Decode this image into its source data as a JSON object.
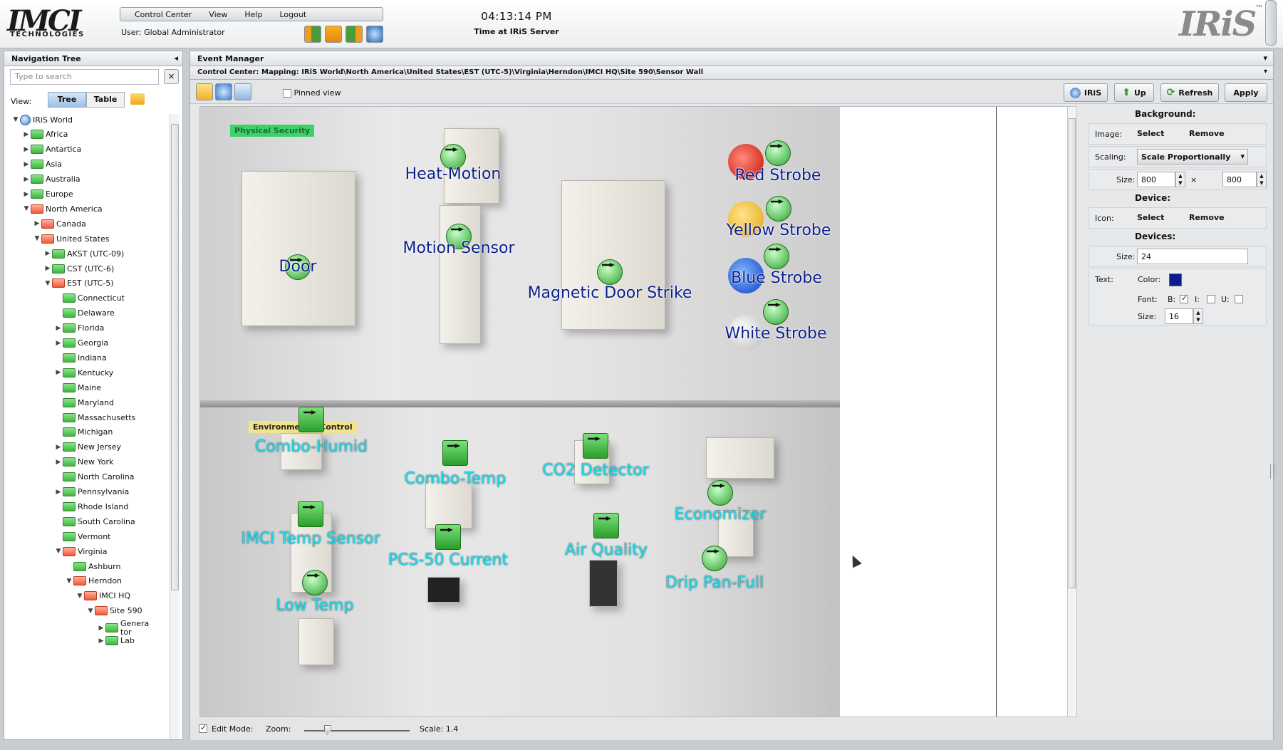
{
  "header": {
    "logo_big": "IMCI",
    "logo_small": "TECHNOLOGIES",
    "menu": [
      "Control Center",
      "View",
      "Help",
      "Logout"
    ],
    "user_label": "User:",
    "user_name": "Global Administrator",
    "clock_time": "04:13:14 PM",
    "clock_caption": "Time at IRiS Server",
    "brand": "IRiS",
    "brand_tm": "™"
  },
  "nav": {
    "title": "Navigation Tree",
    "search_placeholder": "Type to search",
    "clear": "×",
    "view_label": "View:",
    "view_tree": "Tree",
    "view_table": "Table",
    "tree": [
      {
        "label": "IRiS World",
        "level": 0,
        "state": "open",
        "icon": "globe"
      },
      {
        "label": "Africa",
        "level": 1,
        "state": "closed",
        "icon": "green"
      },
      {
        "label": "Antartica",
        "level": 1,
        "state": "closed",
        "icon": "green"
      },
      {
        "label": "Asia",
        "level": 1,
        "state": "closed",
        "icon": "green"
      },
      {
        "label": "Australia",
        "level": 1,
        "state": "closed",
        "icon": "green"
      },
      {
        "label": "Europe",
        "level": 1,
        "state": "closed",
        "icon": "green"
      },
      {
        "label": "North America",
        "level": 1,
        "state": "open",
        "icon": "red"
      },
      {
        "label": "Canada",
        "level": 2,
        "state": "closed",
        "icon": "red"
      },
      {
        "label": "United States",
        "level": 2,
        "state": "open",
        "icon": "red"
      },
      {
        "label": "AKST (UTC-09)",
        "level": 3,
        "state": "closed",
        "icon": "green"
      },
      {
        "label": "CST (UTC-6)",
        "level": 3,
        "state": "closed",
        "icon": "green"
      },
      {
        "label": "EST (UTC-5)",
        "level": 3,
        "state": "open",
        "icon": "red"
      },
      {
        "label": "Connecticut",
        "level": 4,
        "state": "",
        "icon": "green"
      },
      {
        "label": "Delaware",
        "level": 4,
        "state": "",
        "icon": "green"
      },
      {
        "label": "Florida",
        "level": 4,
        "state": "closed",
        "icon": "green"
      },
      {
        "label": "Georgia",
        "level": 4,
        "state": "closed",
        "icon": "green"
      },
      {
        "label": "Indiana",
        "level": 4,
        "state": "",
        "icon": "green"
      },
      {
        "label": "Kentucky",
        "level": 4,
        "state": "closed",
        "icon": "green"
      },
      {
        "label": "Maine",
        "level": 4,
        "state": "",
        "icon": "green"
      },
      {
        "label": "Maryland",
        "level": 4,
        "state": "",
        "icon": "green"
      },
      {
        "label": "Massachusetts",
        "level": 4,
        "state": "",
        "icon": "green"
      },
      {
        "label": "Michigan",
        "level": 4,
        "state": "",
        "icon": "green"
      },
      {
        "label": "New Jersey",
        "level": 4,
        "state": "closed",
        "icon": "green"
      },
      {
        "label": "New York",
        "level": 4,
        "state": "closed",
        "icon": "green"
      },
      {
        "label": "North Carolina",
        "level": 4,
        "state": "",
        "icon": "green"
      },
      {
        "label": "Pennsylvania",
        "level": 4,
        "state": "closed",
        "icon": "green"
      },
      {
        "label": "Rhode Island",
        "level": 4,
        "state": "",
        "icon": "green"
      },
      {
        "label": "South Carolina",
        "level": 4,
        "state": "",
        "icon": "green"
      },
      {
        "label": "Vermont",
        "level": 4,
        "state": "",
        "icon": "green"
      },
      {
        "label": "Virginia",
        "level": 4,
        "state": "open",
        "icon": "red"
      },
      {
        "label": "Ashburn",
        "level": 5,
        "state": "",
        "icon": "green"
      },
      {
        "label": "Herndon",
        "level": 5,
        "state": "open",
        "icon": "red"
      },
      {
        "label": "IMCI HQ",
        "level": 6,
        "state": "open",
        "icon": "red"
      },
      {
        "label": "Site 590",
        "level": 7,
        "state": "open",
        "icon": "red"
      },
      {
        "label": "Genera tor",
        "level": 8,
        "state": "closed",
        "icon": "green"
      },
      {
        "label": "Lab",
        "level": 8,
        "state": "closed",
        "icon": "green"
      }
    ]
  },
  "main": {
    "title": "Event Manager",
    "breadcrumb": "Control Center: Mapping: IRiS World\\North America\\United States\\EST (UTC-5)\\Virginia\\Herndon\\IMCI HQ\\Site 590\\Sensor Wall",
    "pinned_label": "Pinned view",
    "buttons": {
      "iris": "IRiS",
      "up": "Up",
      "refresh": "Refresh",
      "apply": "Apply"
    },
    "photo_tags": {
      "security": "Physical Security",
      "environment": "Environmental Control"
    },
    "devices": [
      {
        "name": "Heat-Motion",
        "color": "blue",
        "kind": "round"
      },
      {
        "name": "Motion Sensor",
        "color": "blue",
        "kind": "round"
      },
      {
        "name": "Door",
        "color": "blue",
        "kind": "round"
      },
      {
        "name": "Magnetic Door Strike",
        "color": "blue",
        "kind": "round"
      },
      {
        "name": "Red Strobe",
        "color": "blue",
        "kind": "round"
      },
      {
        "name": "Yellow Strobe",
        "color": "blue",
        "kind": "round"
      },
      {
        "name": "Blue Strobe",
        "color": "blue",
        "kind": "round"
      },
      {
        "name": "White Strobe",
        "color": "blue",
        "kind": "round"
      },
      {
        "name": "Combo-Humid",
        "color": "cyan",
        "kind": "square"
      },
      {
        "name": "Combo-Temp",
        "color": "cyan",
        "kind": "square"
      },
      {
        "name": "CO2 Detector",
        "color": "cyan",
        "kind": "square"
      },
      {
        "name": "Economizer",
        "color": "cyan",
        "kind": "round"
      },
      {
        "name": "IMCI Temp Sensor",
        "color": "cyan",
        "kind": "square"
      },
      {
        "name": "PCS-50 Current",
        "color": "cyan",
        "kind": "square"
      },
      {
        "name": "Air Quality",
        "color": "cyan",
        "kind": "square"
      },
      {
        "name": "Drip Pan-Full",
        "color": "cyan",
        "kind": "round"
      },
      {
        "name": "Low Temp",
        "color": "cyan",
        "kind": "round"
      }
    ],
    "bottom": {
      "edit_mode": "Edit Mode:",
      "zoom": "Zoom:",
      "scale": "Scale: 1.4",
      "zoom_fraction": 0.22
    }
  },
  "props": {
    "background_title": "Background:",
    "image_label": "Image:",
    "select": "Select",
    "remove": "Remove",
    "scaling_label": "Scaling:",
    "scaling_value": "Scale Proportionally",
    "size_label": "Size:",
    "size_w": "800",
    "size_x": "×",
    "size_h": "800",
    "device_title": "Device:",
    "icon_label": "Icon:",
    "devices_title": "Devices:",
    "devices_size": "24",
    "text_label": "Text:",
    "color_label": "Color:",
    "text_color": "#0a1a8f",
    "font_label": "Font:",
    "b": "B:",
    "i": "I:",
    "u": "U:",
    "font_size": "16"
  }
}
